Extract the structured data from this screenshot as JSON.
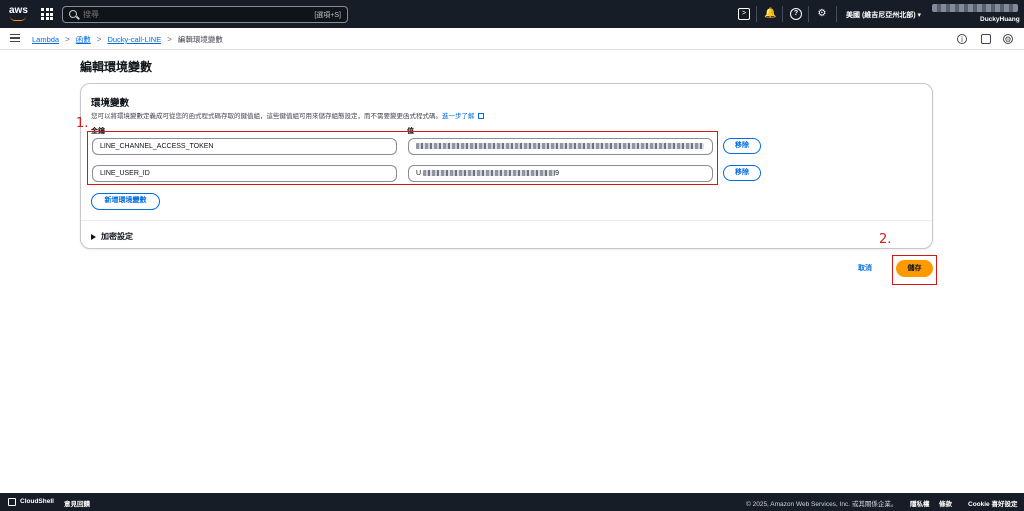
{
  "topnav": {
    "logo": "aws",
    "search_placeholder": "搜尋",
    "search_shortcut": "[選項+S]",
    "icons": [
      "cloudshell-icon",
      "bell-icon",
      "help-icon",
      "gear-icon"
    ],
    "region": "美國 (維吉尼亞州北部) ▾",
    "user": "DuckyHuang"
  },
  "breadcrumb": {
    "items": [
      "Lambda",
      "函數",
      "Ducky-call-LINE"
    ],
    "current": "編輯環境變數"
  },
  "page": {
    "title": "編輯環境變數"
  },
  "env_panel": {
    "title": "環境變數",
    "description": "您可以將環境變數定義成可從您的函式程式碼存取的鍵值組，這些鍵值組可用來儲存組態設定，而不需要變更函式程式碼。",
    "learn_more": "進一步了解",
    "key_label": "金鑰",
    "value_label": "值",
    "rows": [
      {
        "key": "LINE_CHANNEL_ACCESS_TOKEN",
        "value_prefix": "",
        "value_suffix": "",
        "remove": "移除"
      },
      {
        "key": "LINE_USER_ID",
        "value_prefix": "U",
        "value_suffix": "9",
        "remove": "移除"
      }
    ],
    "add_button": "新增環境變數",
    "encryption_toggle": "加密設定"
  },
  "annotations": {
    "marker1": "1.",
    "marker2": "2."
  },
  "actions": {
    "cancel": "取消",
    "save": "儲存"
  },
  "footer": {
    "cloudshell": "CloudShell",
    "feedback": "意見回饋",
    "copyright": "© 2025, Amazon Web Services, Inc. 或其關係企業。",
    "privacy": "隱私權",
    "terms": "條款",
    "cookie": "Cookie 喜好設定"
  },
  "colors": {
    "nav_bg": "#161d26",
    "link": "#006ce0",
    "primary": "#ff9900",
    "annotation": "#d91515"
  }
}
